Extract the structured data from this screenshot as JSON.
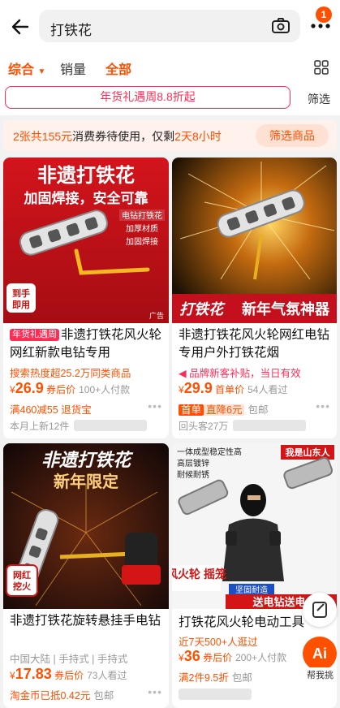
{
  "header": {
    "search_text": "打铁花",
    "message_count": "1"
  },
  "sort_tabs": [
    "综合",
    "销量",
    "全部"
  ],
  "filter": {
    "promo_chip": "年货礼遇周8.8折起",
    "filter_label": "筛选"
  },
  "coupon": {
    "part1": "2张共155元",
    "part2": "消费券待使用，仅剩",
    "part3": "2天8小时",
    "button": "筛选商品"
  },
  "products": [
    {
      "image_title": "非遗打铁花",
      "image_subtitle": "加固焊接，安全可靠",
      "image_tags": [
        "电钻打铁花",
        "加厚材质",
        "加固焊接"
      ],
      "image_corner": "到手即用",
      "ad_label": "广告",
      "tag": "年货礼遇周",
      "title": "非遗打铁花风火轮网红新款电钻专用",
      "sub": "搜索热度超25.2万同类商品",
      "price": "26.9",
      "price_label": "券后价",
      "views": "100+人付款",
      "extra": "满460减55",
      "extra2": "退货宝",
      "shop": "本月上新12件"
    },
    {
      "image_title": "打铁花",
      "image_subtitle": "新年气氛神器",
      "title": "非遗打铁花风火轮网红电钻专用户外打铁花烟",
      "sub": "品牌新客补贴，当日有效",
      "price": "29.9",
      "price_label": "首单价",
      "views": "54人看过",
      "extra_chip": "首单",
      "extra_chip2": "直降6元",
      "extra_g": "包邮",
      "shop": "回头客27万"
    },
    {
      "image_title": "非遗打铁花",
      "image_subtitle": "新年限定",
      "image_corner": "网红挖火",
      "title": "非遗打铁花旋转悬挂手电钻",
      "sub": "中国大陆 | 手持式 | 手持式",
      "price": "17.83",
      "price_label": "券后价",
      "views": "73人看过",
      "extra": "淘金币已抵0.42元",
      "extra_g": "包邮"
    },
    {
      "image_title": "我是山东人",
      "image_subtitle": "风火轮 摇笼",
      "image_banner": "送电钻送电",
      "title": "打铁花风火轮电动工具",
      "sub": "近7天500+人逛过",
      "price": "36",
      "price_label": "券后价",
      "views": "200+人付款",
      "extra": "满2件9.5折",
      "extra_g": "包邮"
    }
  ],
  "fab": {
    "ai_label": "帮我挑"
  },
  "colors": {
    "accent": "#ff5000",
    "promo": "#ff2c56"
  }
}
